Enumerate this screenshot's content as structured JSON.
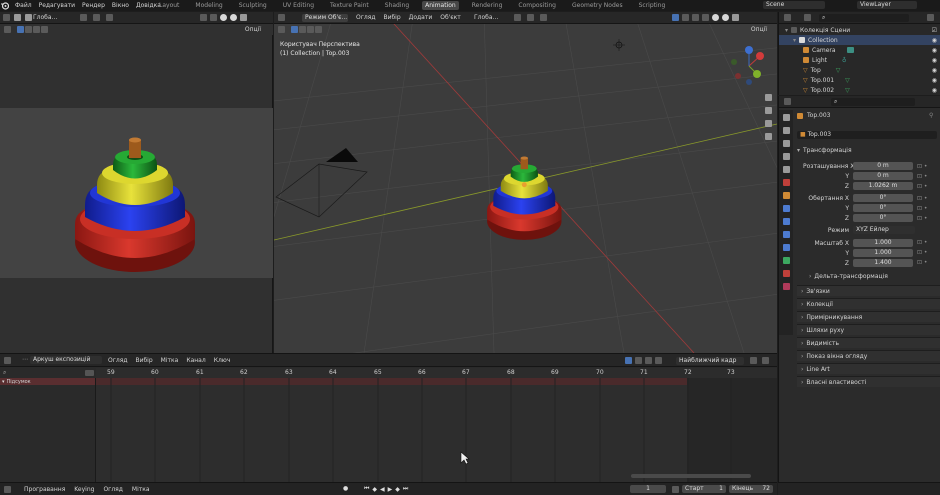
{
  "topbar": {
    "menus": [
      "Файл",
      "Редагувати",
      "Рендер",
      "Вікно",
      "Довідка"
    ],
    "workspaces": [
      "Layout",
      "Modeling",
      "Sculpting",
      "UV Editing",
      "Texture Paint",
      "Shading",
      "Animation",
      "Rendering",
      "Compositing",
      "Geometry Nodes",
      "Scripting"
    ],
    "scene": "Scene",
    "view_layer": "ViewLayer"
  },
  "left_view": {
    "orientation": "Глоба...",
    "options": "Опції"
  },
  "main_view": {
    "mode": "Режим Об'є...",
    "menus": [
      "Огляд",
      "Вибір",
      "Додати",
      "Об'єкт"
    ],
    "orientation": "Глоба...",
    "options": "Опції",
    "perspective_label": "Користувач Перспектива",
    "collection_label": "(1) Collection | Top.003"
  },
  "outliner": {
    "title": "Колекція Сцени",
    "items": [
      {
        "name": "Collection",
        "icon": "collection-icon"
      },
      {
        "name": "Camera",
        "icon": "camera-icon"
      },
      {
        "name": "Light",
        "icon": "light-icon"
      },
      {
        "name": "Top",
        "icon": "mesh-icon"
      },
      {
        "name": "Top.001",
        "icon": "mesh-icon"
      },
      {
        "name": "Top.002",
        "icon": "mesh-icon"
      }
    ]
  },
  "properties": {
    "object_name": "Top.003",
    "object_field": "Top.003",
    "transform_header": "Трансформація",
    "location_label": "Розташування X",
    "location": [
      "0 m",
      "0 m",
      "1.0262 m"
    ],
    "rotation_label": "Обертання X",
    "rotation": [
      "0°",
      "0°",
      "0°"
    ],
    "mode_label": "Режим",
    "mode_value": "XYZ Ейлер",
    "scale_label": "Масштаб X",
    "scale": [
      "1.000",
      "1.000",
      "1.400"
    ],
    "axis_y": "Y",
    "axis_z": "Z",
    "delta_transform": "Дельта-трансформація",
    "sections": [
      "Зв'язки",
      "Колекції",
      "Примірникування",
      "Шляхи руху",
      "Видимість",
      "Показ вікна огляду",
      "Line Art",
      "Власні властивості"
    ]
  },
  "dopesheet": {
    "mode": "Аркуш експозицій",
    "menus": [
      "Огляд",
      "Вибір",
      "Мітка",
      "Канал",
      "Ключ"
    ],
    "snap": "Найближчий кадр",
    "frames": [
      "59",
      "60",
      "61",
      "62",
      "63",
      "64",
      "65",
      "66",
      "67",
      "68",
      "69",
      "70",
      "71",
      "72",
      "73"
    ],
    "summary": "Підсумок"
  },
  "status": {
    "playback": "Програвання",
    "keying": "Keying",
    "view": "Огляд",
    "marker": "Мітка",
    "current_frame": "1",
    "start_label": "Старт",
    "start_value": "1",
    "end_label": "Кінець",
    "end_value": "72"
  },
  "colors": {
    "accent": "#4772b3",
    "active_tab": "#474747",
    "ring_red": "#c42b22",
    "ring_blue": "#1b2fcf",
    "ring_yellow": "#d5cf26",
    "ring_green": "#1f9b2c",
    "stem": "#9d5a1c"
  }
}
